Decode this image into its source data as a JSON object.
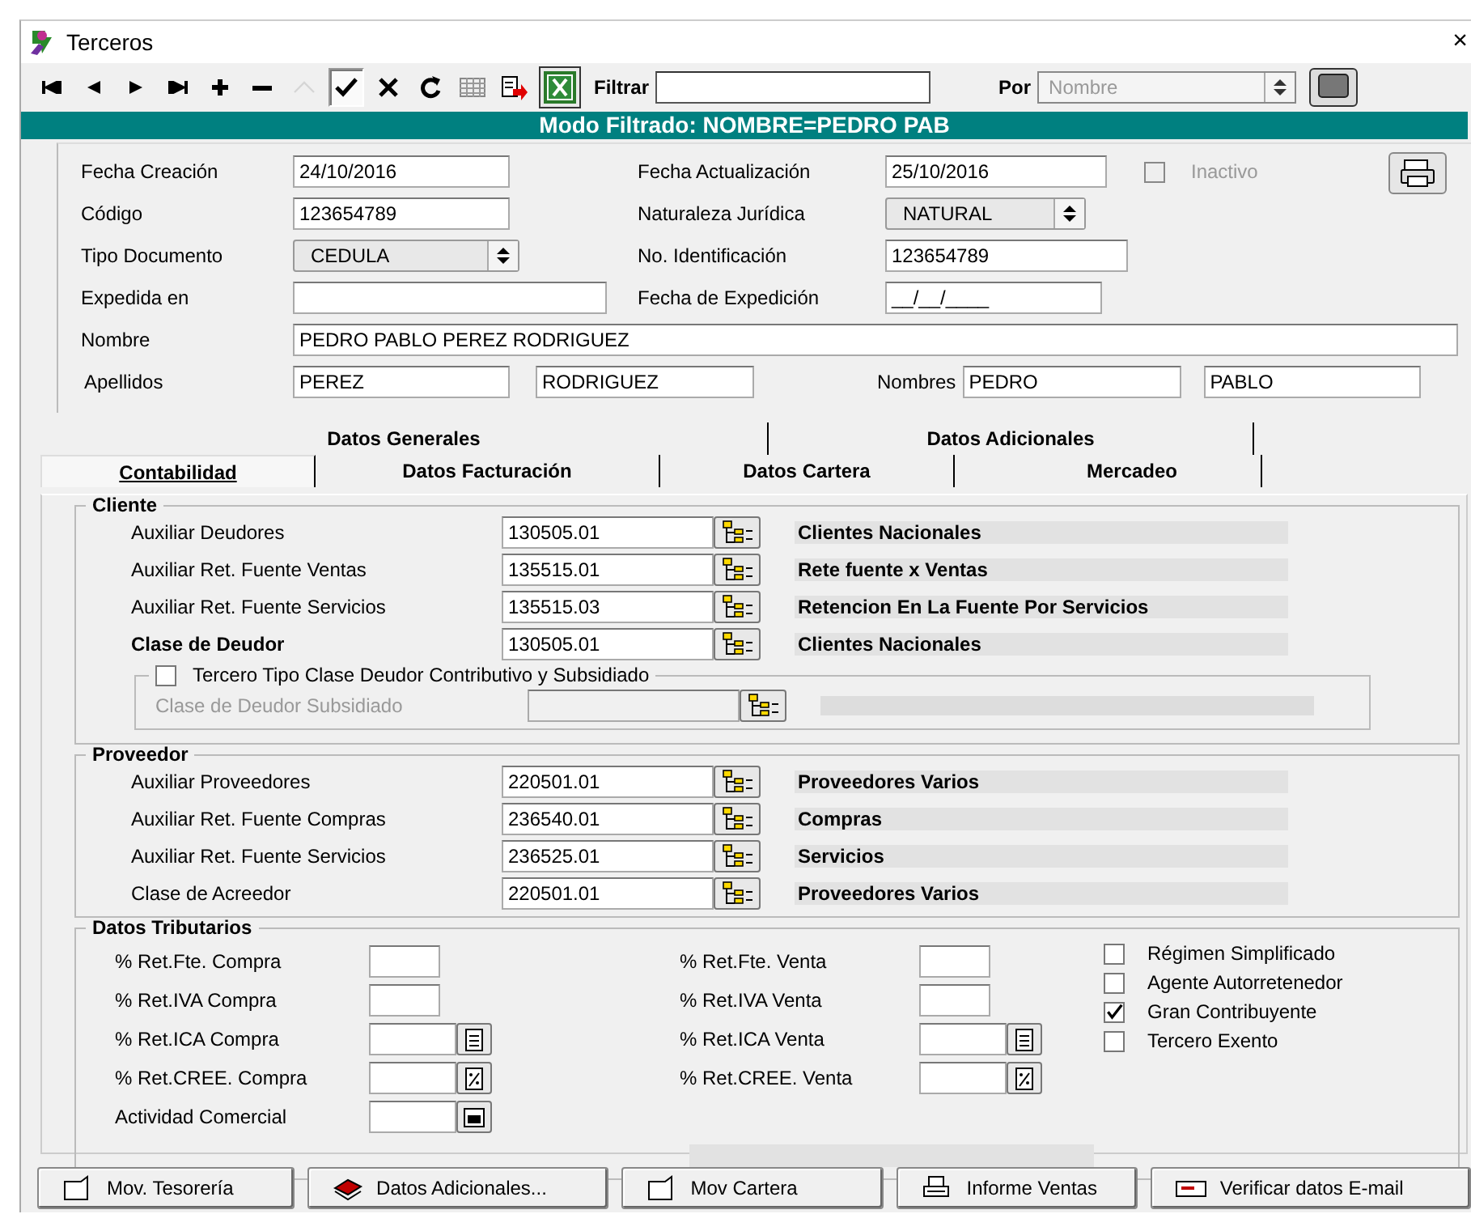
{
  "window": {
    "title": "Terceros",
    "close": "×"
  },
  "toolbar": [
    {
      "kind": "first",
      "disabled": false,
      "selected": false
    },
    {
      "kind": "prev",
      "disabled": false,
      "selected": false
    },
    {
      "kind": "next",
      "disabled": false,
      "selected": false
    },
    {
      "kind": "last",
      "disabled": false,
      "selected": false
    },
    {
      "kind": "add",
      "disabled": false,
      "selected": false
    },
    {
      "kind": "remove",
      "disabled": false,
      "selected": false
    },
    {
      "kind": "edit",
      "disabled": true,
      "selected": false
    },
    {
      "kind": "confirm",
      "disabled": false,
      "selected": true
    },
    {
      "kind": "cancel",
      "disabled": false,
      "selected": false
    },
    {
      "kind": "refresh",
      "disabled": false,
      "selected": false
    },
    {
      "kind": "grid",
      "disabled": false,
      "selected": false
    },
    {
      "kind": "export",
      "disabled": false,
      "selected": false
    },
    {
      "kind": "excel",
      "disabled": false,
      "selected": false
    }
  ],
  "filter": {
    "label": "Filtrar",
    "by_label": "Por",
    "by_placeholder": "Nombre"
  },
  "banner": "Modo Filtrado: NOMBRE=PEDRO PAB",
  "header": {
    "fecha_creacion": {
      "label": "Fecha Creación",
      "value": "24/10/2016"
    },
    "fecha_actualizacion": {
      "label": "Fecha Actualización",
      "value": "25/10/2016"
    },
    "inactivo": {
      "label": "Inactivo",
      "checked": false,
      "disabled": true
    },
    "codigo": {
      "label": "Código",
      "value": "123654789"
    },
    "naturaleza": {
      "label": "Naturaleza Jurídica",
      "value": "NATURAL"
    },
    "tipo_documento": {
      "label": "Tipo Documento",
      "value": "CEDULA"
    },
    "identificacion": {
      "label": "No. Identificación",
      "value": "123654789"
    },
    "expedida_en": {
      "label": "Expedida en"
    },
    "fecha_expedicion": {
      "label": "Fecha de Expedición",
      "value": "__/__/____"
    },
    "nombre": {
      "label": "Nombre",
      "value": "PEDRO PABLO PEREZ RODRIGUEZ"
    },
    "apellidos": {
      "label": "Apellidos",
      "values": [
        "PEREZ",
        "RODRIGUEZ"
      ]
    },
    "nombres": {
      "label": "Nombres",
      "values": [
        "PEDRO",
        "PABLO"
      ]
    }
  },
  "tabs": [
    [
      {
        "label": "Datos Generales",
        "selected": false
      },
      {
        "label": "Datos Adicionales",
        "selected": false
      }
    ],
    [
      {
        "label": "Contabilidad",
        "selected": true
      },
      {
        "label": "Datos Facturación",
        "selected": false
      },
      {
        "label": "Datos Cartera",
        "selected": false
      },
      {
        "label": "Mercadeo",
        "selected": false
      }
    ]
  ],
  "cliente": {
    "title": "Cliente",
    "rows": [
      {
        "label": "Auxiliar Deudores",
        "code": "130505.01",
        "description": "Clientes Nacionales",
        "bold": false
      },
      {
        "label": "Auxiliar Ret. Fuente Ventas",
        "code": "135515.01",
        "description": "Rete fuente  x Ventas",
        "bold": false
      },
      {
        "label": "Auxiliar Ret. Fuente Servicios",
        "code": "135515.03",
        "description": "Retencion En La Fuente Por Servicios",
        "bold": false
      },
      {
        "label": "Clase de Deudor",
        "code": "130505.01",
        "description": "Clientes Nacionales",
        "bold": true
      }
    ],
    "subgroup": {
      "label": "Tercero Tipo Clase Deudor Contributivo y Subsidiado",
      "checked": false,
      "row_label": "Clase de Deudor Subsidiado",
      "disabled": true
    }
  },
  "proveedor": {
    "title": "Proveedor",
    "rows": [
      {
        "label": "Auxiliar Proveedores",
        "code": "220501.01",
        "description": "Proveedores Varios",
        "bold": false
      },
      {
        "label": "Auxiliar Ret. Fuente Compras",
        "code": "236540.01",
        "description": "Compras",
        "bold": false
      },
      {
        "label": "Auxiliar Ret. Fuente Servicios",
        "code": "236525.01",
        "description": "Servicios",
        "bold": false
      },
      {
        "label": "Clase de Acreedor",
        "code": "220501.01",
        "description": "Proveedores Varios",
        "bold": false
      }
    ]
  },
  "tributarios": {
    "title": "Datos Tributarios",
    "rows": [
      [
        {
          "label": "% Ret.Fte. Compra",
          "kind": "plain"
        },
        {
          "label": "% Ret.Fte. Venta",
          "kind": "plain"
        }
      ],
      [
        {
          "label": "% Ret.IVA Compra",
          "kind": "plain"
        },
        {
          "label": "% Ret.IVA Venta",
          "kind": "plain"
        }
      ],
      [
        {
          "label": "% Ret.ICA Compra",
          "kind": "document"
        },
        {
          "label": "% Ret.ICA Venta",
          "kind": "document"
        }
      ],
      [
        {
          "label": "% Ret.CREE. Compra",
          "kind": "percent"
        },
        {
          "label": "% Ret.CREE. Venta",
          "kind": "percent"
        }
      ],
      [
        {
          "label": "Actividad Comercial",
          "kind": "folder"
        }
      ]
    ],
    "checks": [
      {
        "label": "Régimen Simplificado",
        "checked": false
      },
      {
        "label": "Agente Autorretenedor",
        "checked": false
      },
      {
        "label": "Gran Contribuyente",
        "checked": true
      },
      {
        "label": "Tercero Exento",
        "checked": false
      }
    ]
  },
  "buttons": [
    {
      "label": "Mov. Tesorería",
      "kind": "page"
    },
    {
      "label": "Datos Adicionales...",
      "kind": "stack"
    },
    {
      "label": "Mov Cartera",
      "kind": "page"
    },
    {
      "label": "Informe Ventas",
      "kind": "printer"
    },
    {
      "label": "Verificar datos E-mail",
      "kind": "mail"
    }
  ]
}
